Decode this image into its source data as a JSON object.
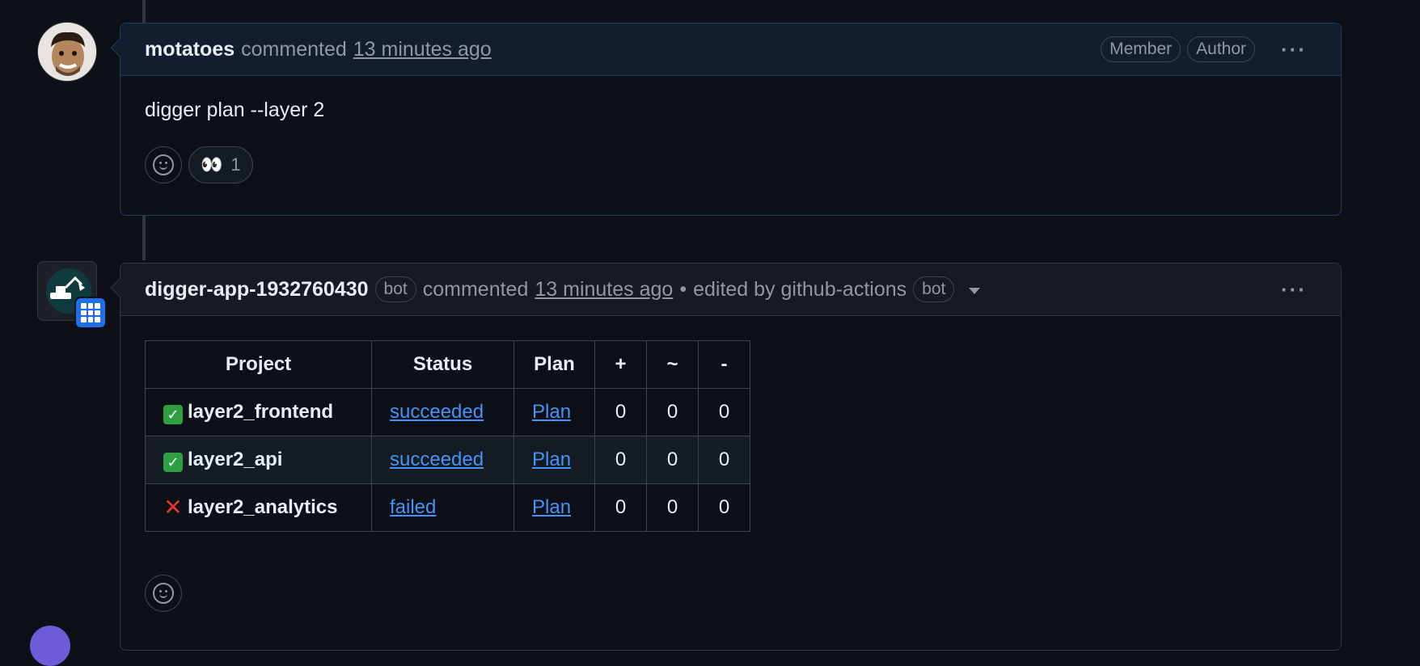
{
  "comment1": {
    "username": "motatoes",
    "action": "commented",
    "time": "13 minutes ago",
    "badges": [
      "Member",
      "Author"
    ],
    "body": "digger plan --layer 2",
    "reaction": {
      "emoji": "👀",
      "count": "1"
    }
  },
  "comment2": {
    "username": "digger-app-1932760430",
    "bot_label": "bot",
    "action": "commented",
    "time": "13 minutes ago",
    "bullet": "•",
    "edited_by": "edited by github-actions",
    "edited_bot_label": "bot",
    "table": {
      "headers": [
        "Project",
        "Status",
        "Plan",
        "+",
        "~",
        "-"
      ],
      "rows": [
        {
          "icon": "check",
          "project": "layer2_frontend",
          "status": "succeeded",
          "plan": "Plan",
          "add": "0",
          "change": "0",
          "destroy": "0"
        },
        {
          "icon": "check",
          "project": "layer2_api",
          "status": "succeeded",
          "plan": "Plan",
          "add": "0",
          "change": "0",
          "destroy": "0"
        },
        {
          "icon": "cross",
          "project": "layer2_analytics",
          "status": "failed",
          "plan": "Plan",
          "add": "0",
          "change": "0",
          "destroy": "0"
        }
      ]
    }
  },
  "icons": {
    "more": "kebab-horizontal-icon",
    "smiley": "smiley-icon",
    "check": "✓",
    "cross": "✕"
  },
  "colors": {
    "background": "#0d1117",
    "link": "#4493f8",
    "success": "#2ea043",
    "danger": "#e5382b"
  }
}
